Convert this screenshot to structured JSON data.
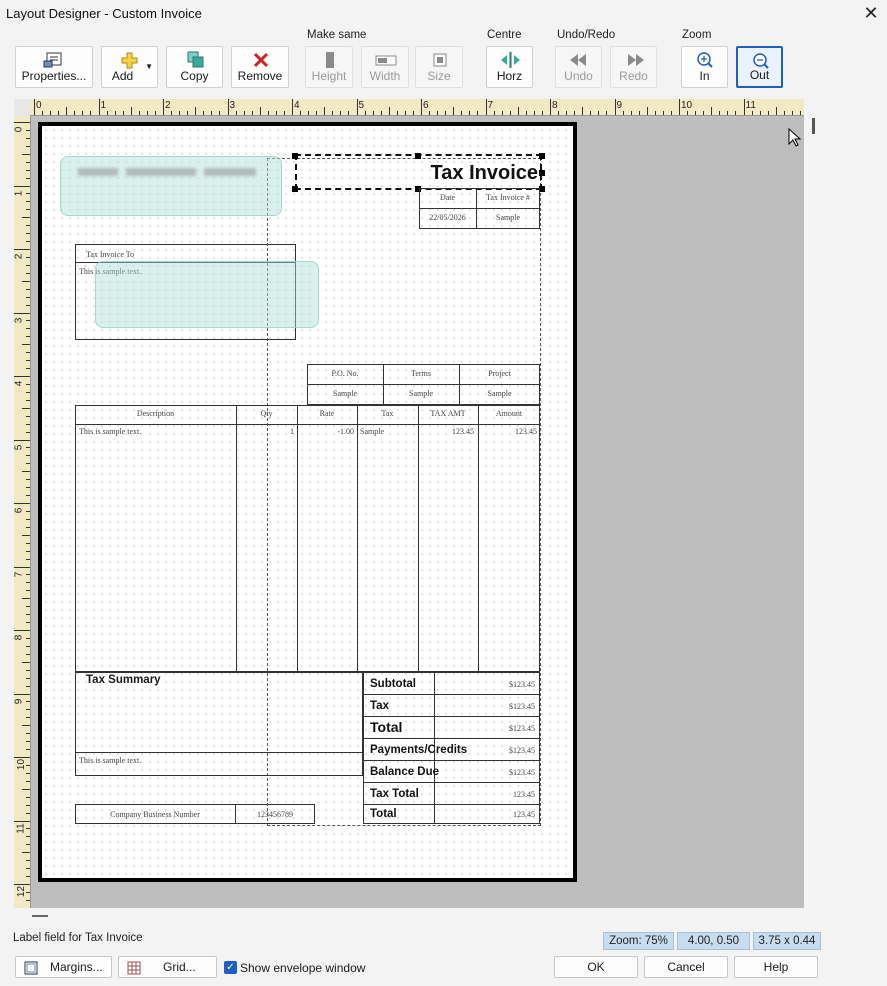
{
  "window": {
    "title": "Layout Designer - Custom Invoice",
    "close_glyph": "✕"
  },
  "toolbar": {
    "groups": {
      "make_same": "Make same",
      "centre": "Centre",
      "undo_redo": "Undo/Redo",
      "zoom": "Zoom"
    },
    "buttons": {
      "properties": "Properties...",
      "add": "Add",
      "copy": "Copy",
      "remove": "Remove",
      "height": "Height",
      "width": "Width",
      "size": "Size",
      "horz": "Horz",
      "undo": "Undo",
      "redo": "Redo",
      "zoom_in": "In",
      "zoom_out": "Out"
    },
    "states": {
      "height": "disabled",
      "width": "disabled",
      "size": "disabled",
      "undo": "disabled",
      "redo": "disabled",
      "zoom_out": "active"
    }
  },
  "rulers": {
    "horizontal": [
      "0",
      "1",
      "2",
      "3",
      "4",
      "5",
      "6",
      "7",
      "8",
      "9",
      "10",
      "11"
    ],
    "vertical": [
      "0",
      "1",
      "2",
      "3",
      "4",
      "5",
      "6",
      "7",
      "8",
      "9",
      "10",
      "11",
      "12"
    ]
  },
  "invoice": {
    "title": "Tax Invoice",
    "date_header": "Date",
    "date_value": "22/05/2026",
    "invoice_no_header": "Tax Invoice #",
    "invoice_no_value": "Sample",
    "bill_to_header": "Tax Invoice To",
    "bill_to_text": "This is sample text.",
    "po_headers": [
      "P.O. No.",
      "Terms",
      "Project"
    ],
    "po_values": [
      "Sample",
      "Sample",
      "Sample"
    ],
    "item_headers": [
      "Description",
      "Qty",
      "Rate",
      "Tax",
      "TAX AMT",
      "Amount"
    ],
    "item_row": [
      "This is sample text.",
      "1",
      "-1.00",
      "Sample",
      "123.45",
      "123.45"
    ],
    "tax_summary": "Tax Summary",
    "footer_text": "This is sample text.",
    "business_number_label": "Company Business Number",
    "business_number_value": "123456789",
    "summary": [
      {
        "label": "Subtotal",
        "value": "$123.45"
      },
      {
        "label": "Tax",
        "value": "$123.45"
      },
      {
        "label": "Total",
        "value": "$123.45"
      },
      {
        "label": "Payments/Credits",
        "value": "$123.45"
      },
      {
        "label": "Balance Due",
        "value": "$123.45"
      },
      {
        "label": "Tax Total",
        "value": "123.45"
      },
      {
        "label": "Total",
        "value": "123.45"
      }
    ]
  },
  "status": {
    "label": "Label field for Tax Invoice",
    "zoom": "Zoom: 75%",
    "position": "4.00, 0.50",
    "size": "3.75 x 0.44"
  },
  "bottom": {
    "margins": "Margins...",
    "grid": "Grid...",
    "envelope_checkbox": "Show envelope window",
    "envelope_checked": true,
    "ok": "OK",
    "cancel": "Cancel",
    "help": "Help"
  },
  "colors": {
    "accent": "#1f5fbf",
    "ruler": "#f1e9c2",
    "canvas": "#bdbdbd",
    "status_box": "#c8dcf0"
  }
}
